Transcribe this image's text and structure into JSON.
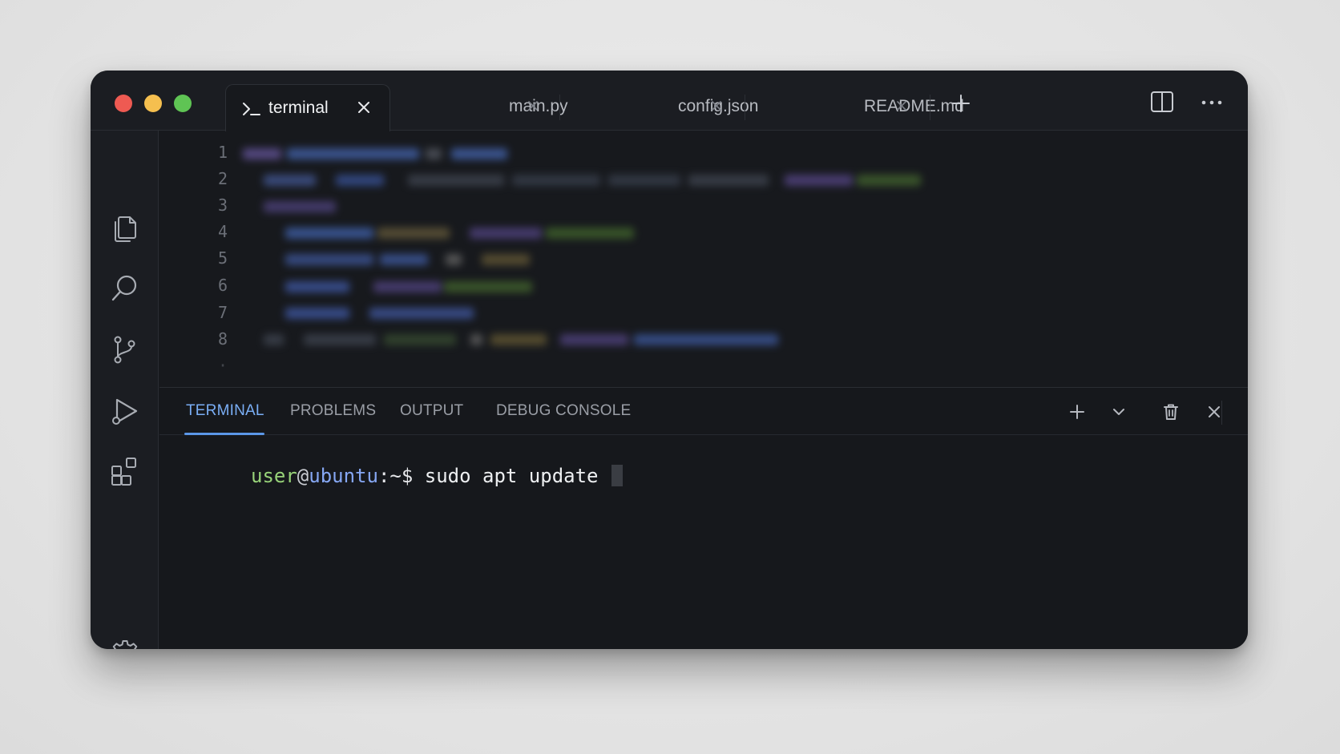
{
  "window": {
    "traffic_lights": [
      "close",
      "minimize",
      "zoom"
    ],
    "colors": {
      "red": "#ee5a52",
      "yellow": "#f5bf4f",
      "green": "#5fc454"
    }
  },
  "tabs": [
    {
      "label": "terminal",
      "active": true,
      "icon": "terminal-prompt-icon"
    },
    {
      "label": "main.py",
      "active": false
    },
    {
      "label": "config.json",
      "active": false
    },
    {
      "label": "README.md",
      "active": false
    }
  ],
  "titlebar_actions": [
    "new-tab-icon",
    "split-editor-icon",
    "more-actions-icon"
  ],
  "activity_bar": [
    "explorer-icon",
    "search-icon",
    "source-control-icon",
    "run-debug-icon",
    "extensions-icon",
    "settings-gear-icon"
  ],
  "editor": {
    "line_numbers": [
      "1",
      "2",
      "3",
      "4",
      "5",
      "6",
      "7",
      "8"
    ]
  },
  "panel": {
    "tabs": [
      "TERMINAL",
      "PROBLEMS",
      "OUTPUT",
      "DEBUG CONSOLE"
    ],
    "active_tab": "TERMINAL",
    "actions": [
      "add-terminal-icon",
      "chevron-down-icon",
      "trash-icon",
      "close-panel-icon"
    ]
  },
  "terminal": {
    "user": "user",
    "at": "@",
    "host": "ubuntu",
    "path": ":~$",
    "command": " sudo apt update"
  },
  "accent": "#5b97e8"
}
